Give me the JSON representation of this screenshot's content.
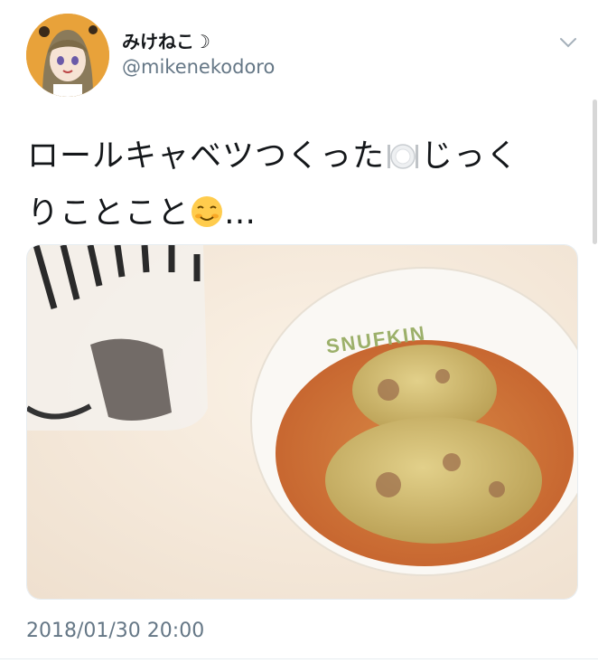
{
  "tweet": {
    "display_name": "みけねこ☽",
    "username": "@mikenekodoro",
    "text_line1_a": "ロールキャベツつくった",
    "text_line1_b": "じっく",
    "text_line2_a": "りことこと",
    "text_line2_b": "…",
    "emoji_1": "plate-with-cutlery-emoji",
    "emoji_2": "smiling-blushing-face-emoji",
    "timestamp": "2018/01/30 20:00"
  },
  "media": {
    "bowl_text": "SNUFKIN"
  },
  "colors": {
    "text": "#14171a",
    "secondary": "#657786",
    "border": "#e6ecf0"
  }
}
